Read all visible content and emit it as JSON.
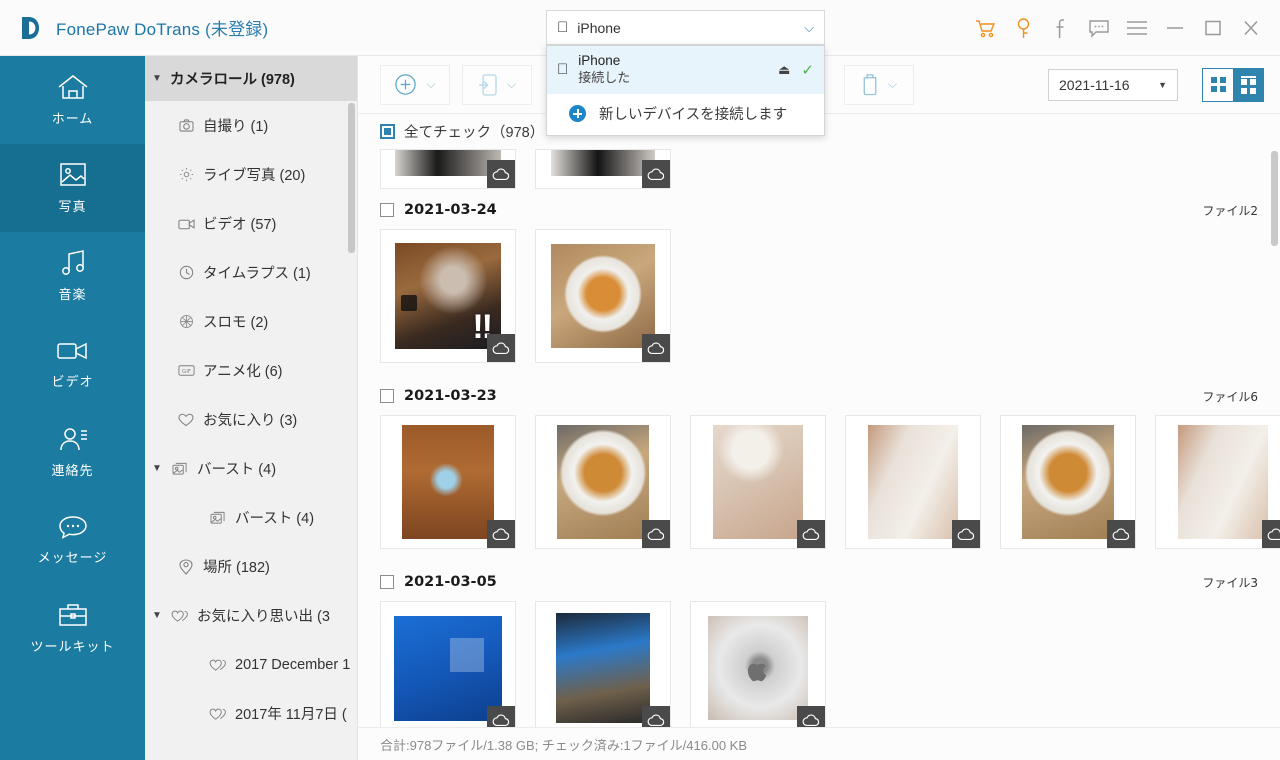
{
  "titlebar": {
    "app_name": "FonePaw DoTrans",
    "reg_status": "(未登録)",
    "logo_letter": "D",
    "icons": [
      {
        "name": "cart-icon",
        "glyph": "cart",
        "color": "#f0901e"
      },
      {
        "name": "key-icon",
        "glyph": "key",
        "color": "#f0901e"
      },
      {
        "name": "facebook-icon",
        "glyph": "f",
        "color": "#9a9a9a"
      },
      {
        "name": "feedback-icon",
        "glyph": "chat",
        "color": "#9a9a9a"
      },
      {
        "name": "menu-icon",
        "glyph": "hamburger",
        "color": "#9a9a9a"
      },
      {
        "name": "minimize-icon",
        "glyph": "minus",
        "color": "#9a9a9a"
      },
      {
        "name": "maximize-icon",
        "glyph": "square",
        "color": "#9a9a9a"
      },
      {
        "name": "close-icon",
        "glyph": "x",
        "color": "#9a9a9a"
      }
    ]
  },
  "device": {
    "selected_label": "iPhone",
    "dropdown_open": true,
    "options": [
      {
        "name": "iPhone",
        "status": "接続した",
        "connected": true,
        "eject_icon": "eject-icon",
        "check_icon": "check-icon"
      },
      {
        "name": "新しいデバイスを接続します",
        "status": "",
        "connected": false,
        "add_icon": "plus-circle-icon"
      }
    ]
  },
  "sidebar": {
    "items": [
      {
        "label": "ホーム",
        "icon": "home-icon",
        "active": false
      },
      {
        "label": "写真",
        "icon": "photo-icon",
        "active": true
      },
      {
        "label": "音楽",
        "icon": "music-icon",
        "active": false
      },
      {
        "label": "ビデオ",
        "icon": "video-icon",
        "active": false
      },
      {
        "label": "連絡先",
        "icon": "contacts-icon",
        "active": false
      },
      {
        "label": "メッセージ",
        "icon": "message-icon",
        "active": false
      },
      {
        "label": "ツールキット",
        "icon": "toolkit-icon",
        "active": false
      }
    ]
  },
  "tree": {
    "header": {
      "label": "カメラロール (978)",
      "expanded": true
    },
    "items": [
      {
        "label": "自撮り (1)",
        "icon": "camera-icon",
        "indent": 1,
        "caret": ""
      },
      {
        "label": "ライブ写真 (20)",
        "icon": "live-photo-icon",
        "indent": 1,
        "caret": ""
      },
      {
        "label": "ビデオ (57)",
        "icon": "video-icon",
        "indent": 1,
        "caret": ""
      },
      {
        "label": "タイムラプス (1)",
        "icon": "clock-icon",
        "indent": 1,
        "caret": ""
      },
      {
        "label": "スロモ (2)",
        "icon": "slowmo-icon",
        "indent": 1,
        "caret": ""
      },
      {
        "label": "アニメ化 (6)",
        "icon": "gif-icon",
        "indent": 1,
        "caret": ""
      },
      {
        "label": "お気に入り (3)",
        "icon": "heart-icon",
        "indent": 1,
        "caret": ""
      },
      {
        "label": "バースト (4)",
        "icon": "burst-icon",
        "indent": 0,
        "caret": "▼"
      },
      {
        "label": "バースト (4)",
        "icon": "burst-icon",
        "indent": 2,
        "caret": ""
      },
      {
        "label": "場所 (182)",
        "icon": "location-icon",
        "indent": 1,
        "caret": ""
      },
      {
        "label": "お気に入り思い出 (3",
        "icon": "hearts-icon",
        "indent": 0,
        "caret": "▼"
      },
      {
        "label": "2017 December 1",
        "icon": "hearts-icon",
        "indent": 2,
        "caret": ""
      },
      {
        "label": "2017年 11月7日 (",
        "icon": "hearts-icon",
        "indent": 2,
        "caret": ""
      }
    ]
  },
  "toolbar": {
    "add_button": {
      "name": "add-button",
      "icon": "plus-circle-icon",
      "caret": "⌄"
    },
    "export_button": {
      "name": "export-to-device-button",
      "icon": "device-export-icon",
      "caret": "⌄"
    },
    "hidden_button": {
      "name": "delete-button",
      "icon": "trash-icon",
      "caret": "⌄"
    },
    "date_filter": {
      "value": "2021-11-16",
      "caret": "▼"
    },
    "view_small": {
      "name": "view-small-grid",
      "selected": false
    },
    "view_large": {
      "name": "view-large-grid",
      "selected": true
    }
  },
  "checkall": {
    "label": "全てチェック（978）",
    "checked": true
  },
  "groups": [
    {
      "date": "2021-03-24",
      "file_label": "ファイル2",
      "checked": false,
      "thumbs": [
        {
          "alt": "cat-with-exclamation",
          "style": "p-cat1",
          "badge": "cloud-icon",
          "overlay": "tiktok"
        },
        {
          "alt": "bread-on-plate",
          "style": "p-bun",
          "badge": "cloud-icon",
          "overlay": ""
        }
      ]
    },
    {
      "date": "2021-03-23",
      "file_label": "ファイル6",
      "checked": false,
      "thumbs": [
        {
          "alt": "alice-cartoon",
          "style": "p-alice",
          "badge": "cloud-icon",
          "overlay": ""
        },
        {
          "alt": "bread-on-plate-2",
          "style": "p-bun2",
          "badge": "cloud-icon",
          "overlay": ""
        },
        {
          "alt": "cat-closeup-1",
          "style": "p-cat2",
          "badge": "cloud-icon",
          "overlay": ""
        },
        {
          "alt": "cat-closeup-2",
          "style": "p-cat3",
          "badge": "cloud-icon",
          "overlay": ""
        },
        {
          "alt": "bread-on-plate-3",
          "style": "p-bun2",
          "badge": "cloud-icon",
          "overlay": ""
        },
        {
          "alt": "cat-closeup-3",
          "style": "p-cat3",
          "badge": "cloud-icon",
          "overlay": ""
        }
      ]
    },
    {
      "date": "2021-03-05",
      "file_label": "ファイル3",
      "checked": false,
      "thumbs": [
        {
          "alt": "windows-desktop",
          "style": "p-win",
          "badge": "cloud-icon",
          "overlay": "win"
        },
        {
          "alt": "monitor-desk-setup",
          "style": "p-desk",
          "badge": "cloud-icon",
          "overlay": ""
        },
        {
          "alt": "apple-logo-laptop",
          "style": "p-apple",
          "badge": "cloud-icon",
          "overlay": "apple"
        }
      ]
    }
  ],
  "status": {
    "text": "合計:978ファイル/1.38 GB; チェック済み:1ファイル/416.00 KB"
  },
  "colors": {
    "brand": "#1b7ba0",
    "brand_active": "#166e91",
    "accent_orange": "#f0901e",
    "link_blue": "#2e84ac"
  }
}
